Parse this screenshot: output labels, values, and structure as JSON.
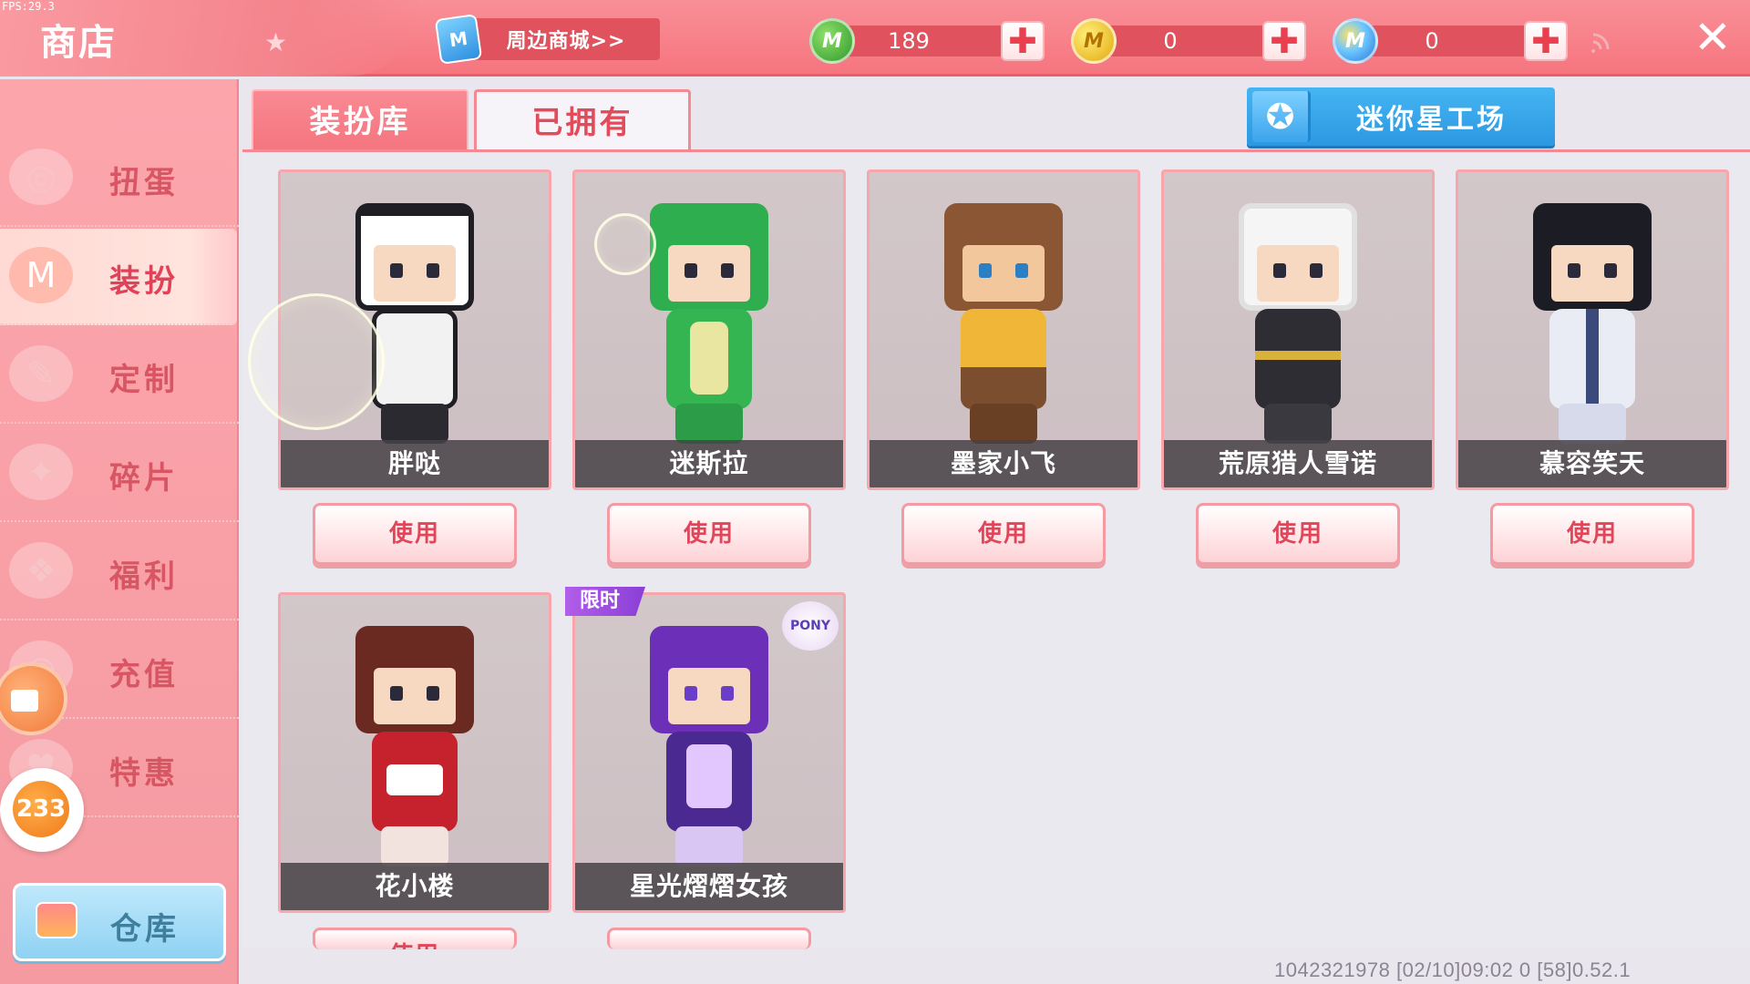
{
  "status": {
    "fps": "FPS:29.3"
  },
  "header": {
    "title": "商店",
    "mall_link": "周边商城>>",
    "bag_icon_letter": "M",
    "currencies": [
      {
        "icon": "mini-bean-icon",
        "letter": "M",
        "color": "#3fae35",
        "value": "189"
      },
      {
        "icon": "mini-coin-icon",
        "letter": "M",
        "color": "#e8b312",
        "value": "0"
      },
      {
        "icon": "mini-point-icon",
        "letter": "M",
        "color": "#2f86e0",
        "value": "0"
      }
    ],
    "plus_symbol": "✚",
    "close_symbol": "✕"
  },
  "sidebar": {
    "items": [
      {
        "label": "扭蛋",
        "icon": "gacha-icon",
        "active": false
      },
      {
        "label": "装扮",
        "icon": "outfit-icon",
        "active": true
      },
      {
        "label": "定制",
        "icon": "customize-icon",
        "active": false
      },
      {
        "label": "碎片",
        "icon": "fragment-icon",
        "active": false
      },
      {
        "label": "福利",
        "icon": "welfare-icon",
        "active": false
      },
      {
        "label": "充值",
        "icon": "recharge-icon",
        "active": false
      },
      {
        "label": "特惠",
        "icon": "discount-icon",
        "active": false
      }
    ],
    "warehouse": "仓库",
    "badge_233": "233"
  },
  "tabs": {
    "library": "装扮库",
    "owned": "已拥有",
    "active": "owned"
  },
  "workshop": {
    "label": "迷你星工场",
    "icon": "star-icon"
  },
  "skins": [
    {
      "name": "胖哒",
      "action": "使用",
      "head": "#ffffff",
      "body": "#f2f2f2",
      "accent": "#1e1e24"
    },
    {
      "name": "迷斯拉",
      "action": "使用",
      "head": "#2fae4f",
      "body": "#35b552",
      "accent": "#e8e6a0"
    },
    {
      "name": "墨家小飞",
      "action": "使用",
      "head": "#8a5634",
      "body": "#7a4e2f",
      "accent": "#f0b638"
    },
    {
      "name": "荒原猎人雪诺",
      "action": "使用",
      "head": "#f5f5f5",
      "body": "#2e2d33",
      "accent": "#d8b23a"
    },
    {
      "name": "慕容笑天",
      "action": "使用",
      "head": "#1c1c24",
      "body": "#e9ecf5",
      "accent": "#3a4a7a"
    },
    {
      "name": "花小楼",
      "action": "使用",
      "head": "#6a2a22",
      "body": "#c6222e",
      "accent": "#ffffff"
    },
    {
      "name": "星光熠熠女孩",
      "action": "",
      "head": "#6b2fb8",
      "body": "#4a2a90",
      "accent": "#e2c7ff",
      "limited": "限时",
      "logo": "PONY"
    }
  ],
  "footer": {
    "info": "1042321978   [02/10]09:02 0 [58]0.52.1"
  }
}
